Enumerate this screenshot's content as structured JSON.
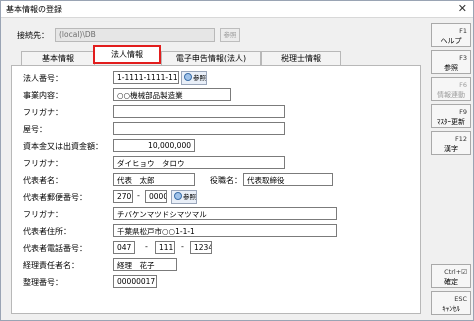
{
  "window": {
    "title": "基本情報の登録",
    "close": "✕"
  },
  "connection": {
    "label": "接続先：",
    "value": "(local)\\DB",
    "button": "参照"
  },
  "tabs": [
    {
      "label": "基本情報"
    },
    {
      "label": "法人情報"
    },
    {
      "label": "電子申告情報(法人)"
    },
    {
      "label": "税理士情報"
    }
  ],
  "form": {
    "corp_number": {
      "label": "法人番号：",
      "value": "1-1111-1111-1111",
      "button": "参照"
    },
    "business": {
      "label": "事業内容：",
      "value": "○○機械部品製造業"
    },
    "furigana1": {
      "label": "フリガナ：",
      "value": ""
    },
    "trade_name": {
      "label": "屋号：",
      "value": ""
    },
    "capital": {
      "label": "資本金又は出資金額：",
      "value": "10,000,000"
    },
    "furigana2": {
      "label": "フリガナ：",
      "value": "ダイヒョウ　タロウ"
    },
    "rep_name": {
      "label": "代表者名：",
      "value": "代表　太郎"
    },
    "rep_title": {
      "label": "役職名：",
      "value": "代表取締役"
    },
    "rep_zip": {
      "label": "代表者郵便番号：",
      "part1": "270",
      "dash": "-",
      "part2": "0000",
      "button": "参照"
    },
    "furigana3": {
      "label": "フリガナ：",
      "value": "チバケンマツドシマツマル"
    },
    "rep_address": {
      "label": "代表者住所：",
      "value": "千葉県松戸市○○1-1-1"
    },
    "rep_phone": {
      "label": "代表者電話番号：",
      "part1": "047",
      "part2": "111",
      "part3": "1234",
      "dash": "-"
    },
    "accountant": {
      "label": "経理責任者名：",
      "value": "経理　花子"
    },
    "ref_number": {
      "label": "整理番号：",
      "value": "00000017"
    }
  },
  "sidebar": [
    {
      "key": "F1",
      "label": "ヘルプ",
      "enabled": true
    },
    {
      "key": "F3",
      "label": "参照",
      "enabled": true
    },
    {
      "key": "F6",
      "label": "情報連動",
      "enabled": false
    },
    {
      "key": "F9",
      "label": "ﾏｽﾀｰ更新",
      "enabled": true
    },
    {
      "key": "F12",
      "label": "漢字",
      "enabled": true
    },
    {
      "key": "Ctrl+☑",
      "label": "確定",
      "enabled": true
    },
    {
      "key": "ESC",
      "label": "ｷｬﾝｾﾙ",
      "enabled": true
    }
  ],
  "colors": {
    "highlight": "#e21d1d",
    "panel_bg": "#f0f0f0",
    "field_border": "#7b7b7b"
  }
}
